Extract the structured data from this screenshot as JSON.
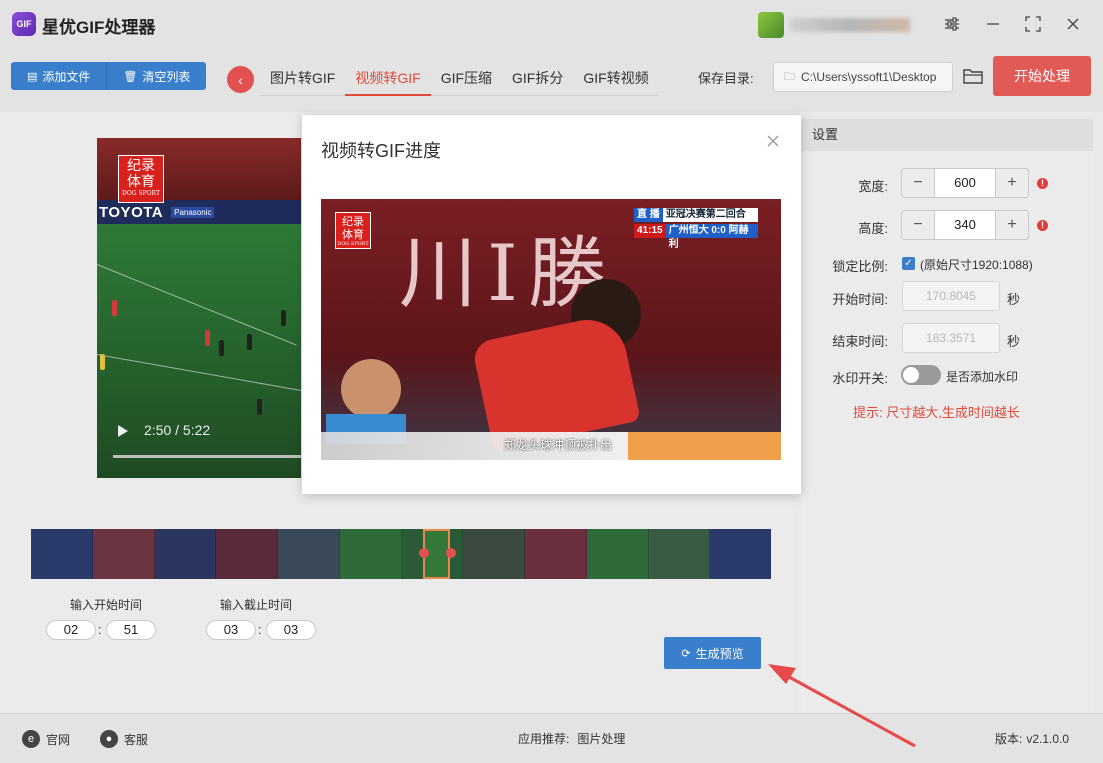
{
  "app": {
    "title": "星优GIF处理器",
    "logo_text": "GIF"
  },
  "window_controls": {
    "settings_icon": "sliders-icon",
    "minimize": "—",
    "maximize": "⛶",
    "close": "✕"
  },
  "toolbar": {
    "add_file_label": "添加文件",
    "clear_list_label": "清空列表",
    "tabs": [
      {
        "label": "图片转GIF",
        "active": false
      },
      {
        "label": "视频转GIF",
        "active": true
      },
      {
        "label": "GIF压缩",
        "active": false
      },
      {
        "label": "GIF拆分",
        "active": false
      },
      {
        "label": "GIF转视频",
        "active": false
      }
    ],
    "save_dir_label": "保存目录:",
    "save_dir_value": "C:\\Users\\yssoft1\\Desktop",
    "start_label": "开始处理"
  },
  "player": {
    "time": "2:50 / 5:22",
    "brand_banner": "TOYOTA",
    "sponsor": "Panasonic",
    "logo_line1": "纪录",
    "logo_line2": "体育",
    "logo_line3": "DOG SPORT"
  },
  "trim": {
    "start_label": "输入开始时间",
    "end_label": "输入截止时间",
    "start_min": "02",
    "start_sec": "51",
    "end_min": "03",
    "end_sec": "03",
    "separator": ":",
    "preview_label": "生成预览"
  },
  "settings": {
    "header": "设置",
    "width_label": "宽度:",
    "width_value": "600",
    "height_label": "高度:",
    "height_value": "340",
    "lock_label": "锁定比例:",
    "lock_text": "(原始尺寸1920:1088)",
    "start_time_label": "开始时间:",
    "start_time_value": "170.8045",
    "end_time_label": "结束时间:",
    "end_time_value": "183.3571",
    "seconds_unit": "秒",
    "watermark_label": "水印开关:",
    "watermark_text": "是否添加水印",
    "hint": "提示: 尺寸越大,生成时间越长"
  },
  "dialog": {
    "title": "视频转GIF进度",
    "gif": {
      "big_text": "川I勝",
      "caption": "郑龙头球冲顶被扑出",
      "score_tag": "直 播",
      "score_title": "亚冠决赛第二回合",
      "score_time": "41:15",
      "score_line": "广州恒大 0:0 阿赫利",
      "logo_line1": "纪录",
      "logo_line2": "体育",
      "logo_line3": "DOG SPORT"
    }
  },
  "footer": {
    "website_label": "官网",
    "support_label": "客服",
    "recommend_label": "应用推荐:",
    "recommend_value": "图片处理",
    "version_label": "版本:",
    "version_value": "v2.1.0.0"
  },
  "colors": {
    "accent_red": "#e24a3b",
    "primary_blue": "#3a7fcb",
    "start_btn": "#e25a55"
  }
}
